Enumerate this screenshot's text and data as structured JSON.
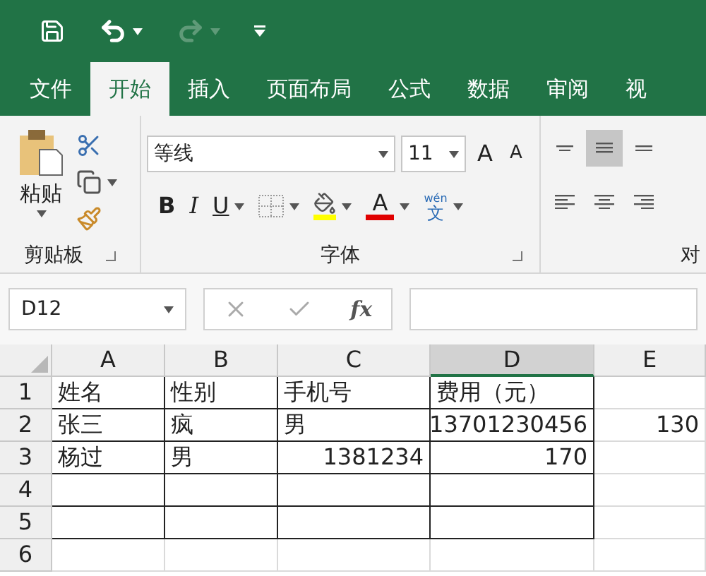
{
  "quick_access": [
    {
      "kind": "save",
      "disabled": false
    },
    {
      "kind": "undo",
      "disabled": false
    },
    {
      "kind": "redo",
      "disabled": true
    },
    {
      "kind": "customize",
      "disabled": false
    }
  ],
  "tabs": [
    {
      "label": "文件",
      "selected": false
    },
    {
      "label": "开始",
      "selected": true
    },
    {
      "label": "插入",
      "selected": false
    },
    {
      "label": "页面布局",
      "selected": false
    },
    {
      "label": "公式",
      "selected": false
    },
    {
      "label": "数据",
      "selected": false
    },
    {
      "label": "审阅",
      "selected": false
    },
    {
      "label": "视",
      "selected": false
    }
  ],
  "clipboard": {
    "paste_label": "粘贴",
    "group_label": "剪贴板"
  },
  "font": {
    "name": "等线",
    "size": "11",
    "grow": "A",
    "shrink": "A",
    "bold": "B",
    "italic": "I",
    "underline": "U",
    "font_color": "A",
    "phonetic_top": "wén",
    "phonetic_char": "文",
    "group_label": "字体"
  },
  "alignment": {
    "group_label": "对",
    "buttons": [
      {
        "kind": "top",
        "selected": false
      },
      {
        "kind": "middle",
        "selected": true
      },
      {
        "kind": "bottom",
        "selected": false
      },
      {
        "kind": "left",
        "selected": false
      },
      {
        "kind": "center",
        "selected": false
      },
      {
        "kind": "right",
        "selected": false
      }
    ]
  },
  "formula_bar": {
    "name_box": "D12",
    "fx": "fx"
  },
  "columns": [
    {
      "label": "A",
      "selected": false,
      "bordered": true
    },
    {
      "label": "B",
      "selected": false,
      "bordered": true
    },
    {
      "label": "C",
      "selected": false,
      "bordered": true
    },
    {
      "label": "D",
      "selected": true,
      "bordered": true
    },
    {
      "label": "E",
      "selected": false,
      "bordered": false
    }
  ],
  "rows": [
    {
      "number": "1",
      "bordered": true,
      "cells": [
        {
          "text": "姓名",
          "kind": "text"
        },
        {
          "text": "性别",
          "kind": "text"
        },
        {
          "text": "手机号",
          "kind": "text"
        },
        {
          "text": "费用（元）",
          "kind": "text"
        },
        {
          "text": "",
          "kind": "text"
        }
      ]
    },
    {
      "number": "2",
      "bordered": true,
      "cells": [
        {
          "text": "张三",
          "kind": "text"
        },
        {
          "text": "疯",
          "kind": "text"
        },
        {
          "text": "男",
          "kind": "text"
        },
        {
          "text": "13701230456",
          "kind": "number"
        },
        {
          "text": "130",
          "kind": "number"
        }
      ]
    },
    {
      "number": "3",
      "bordered": true,
      "cells": [
        {
          "text": "杨过",
          "kind": "text"
        },
        {
          "text": "男",
          "kind": "text"
        },
        {
          "text": "1381234",
          "kind": "number"
        },
        {
          "text": "170",
          "kind": "number"
        },
        {
          "text": "",
          "kind": "text"
        }
      ]
    },
    {
      "number": "4",
      "bordered": true,
      "cells": [
        {
          "text": "",
          "kind": "text"
        },
        {
          "text": "",
          "kind": "text"
        },
        {
          "text": "",
          "kind": "text"
        },
        {
          "text": "",
          "kind": "text"
        },
        {
          "text": "",
          "kind": "text"
        }
      ]
    },
    {
      "number": "5",
      "bordered": true,
      "cells": [
        {
          "text": "",
          "kind": "text"
        },
        {
          "text": "",
          "kind": "text"
        },
        {
          "text": "",
          "kind": "text"
        },
        {
          "text": "",
          "kind": "text"
        },
        {
          "text": "",
          "kind": "text"
        }
      ]
    },
    {
      "number": "6",
      "bordered": false,
      "cells": [
        {
          "text": "",
          "kind": "text"
        },
        {
          "text": "",
          "kind": "text"
        },
        {
          "text": "",
          "kind": "text"
        },
        {
          "text": "",
          "kind": "text"
        },
        {
          "text": "",
          "kind": "text"
        }
      ]
    }
  ]
}
